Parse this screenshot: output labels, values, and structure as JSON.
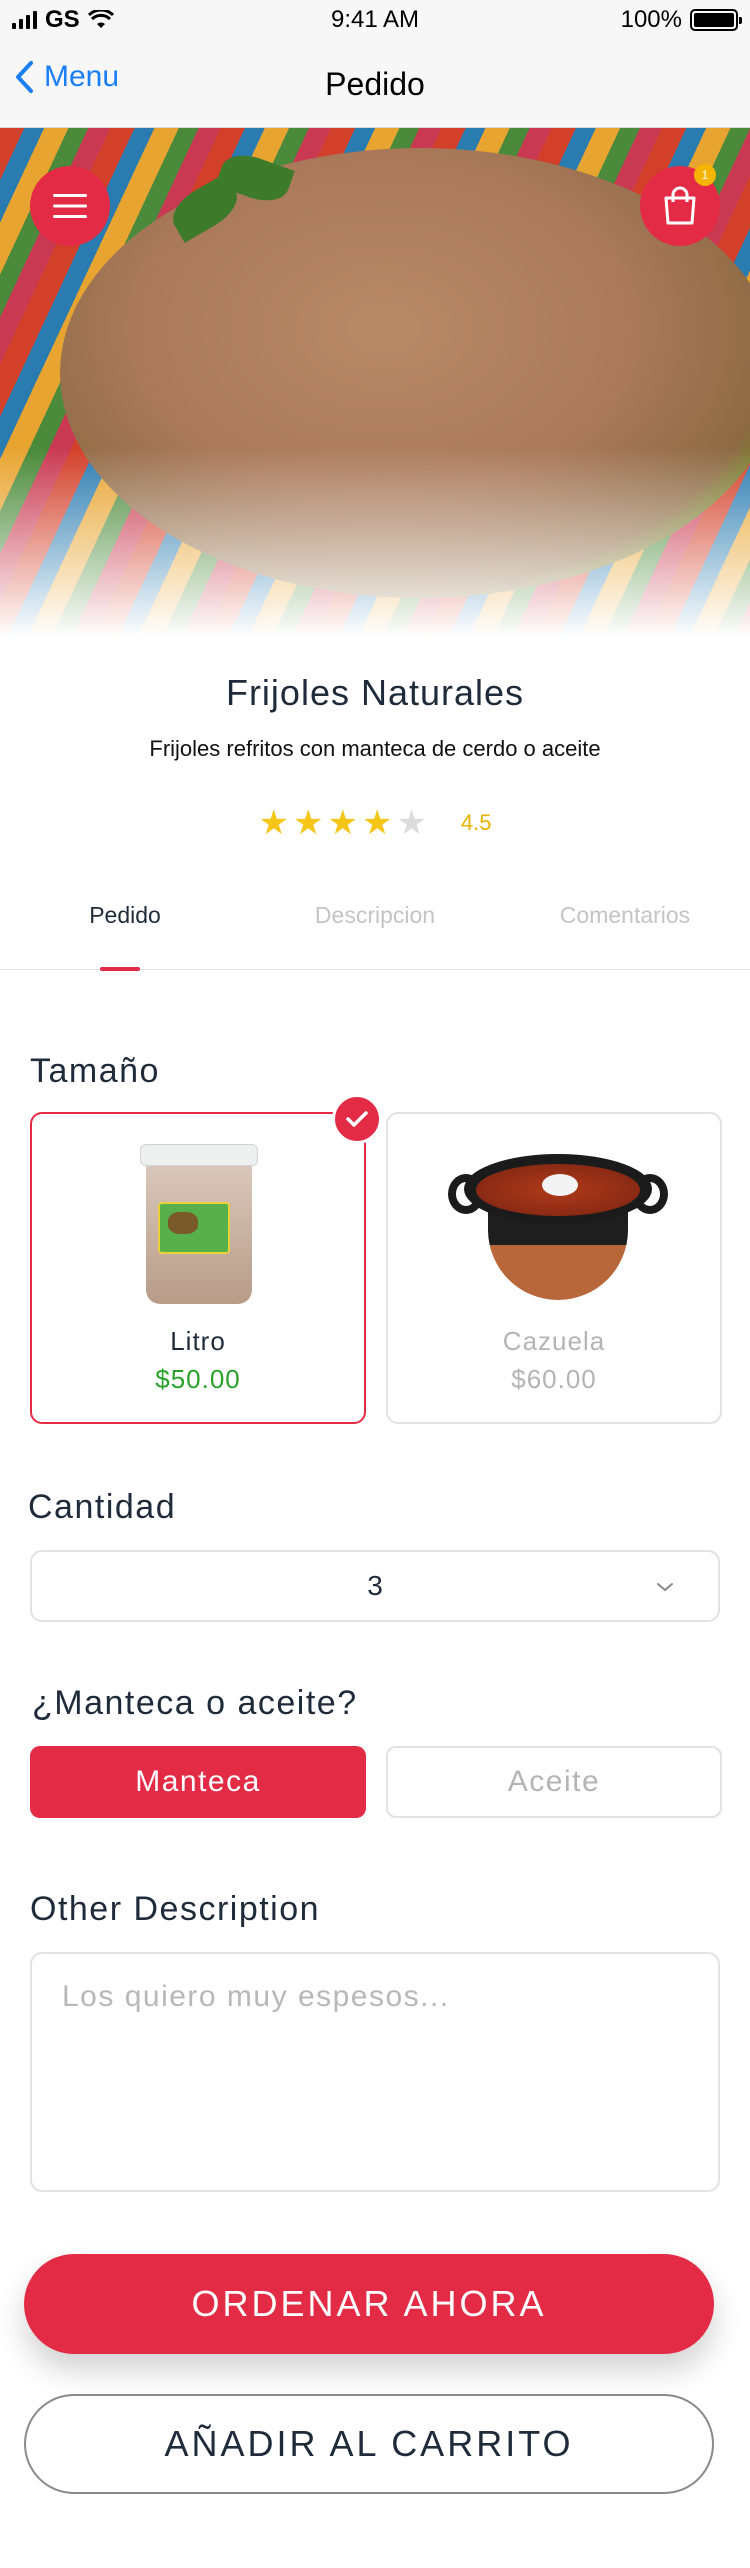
{
  "status_bar": {
    "carrier": "GS",
    "time": "9:41 AM",
    "battery": "100%"
  },
  "nav": {
    "back_label": "Menu",
    "title": "Pedido"
  },
  "hero": {
    "cart_count": "1"
  },
  "product": {
    "title": "Frijoles Naturales",
    "subtitle": "Frijoles refritos con manteca de cerdo o aceite",
    "rating_value": "4.5",
    "rating_stars": 4,
    "rating_max": 5
  },
  "tabs": [
    {
      "label": "Pedido"
    },
    {
      "label": "Descripcion"
    },
    {
      "label": "Comentarios"
    }
  ],
  "size": {
    "label": "Tamaño",
    "options": [
      {
        "name": "Litro",
        "price": "$50.00",
        "selected": true
      },
      {
        "name": "Cazuela",
        "price": "$60.00",
        "selected": false
      }
    ]
  },
  "quantity": {
    "label": "Cantidad",
    "value": "3"
  },
  "fat": {
    "label": "¿Manteca o aceite?",
    "options": [
      "Manteca",
      "Aceite"
    ],
    "selected": "Manteca"
  },
  "other": {
    "label": "Other Description",
    "placeholder": "Los quiero muy espesos..."
  },
  "actions": {
    "order_now": "ORDENAR AHORA",
    "add_to_cart": "AÑADIR AL CARRITO"
  },
  "colors": {
    "accent": "#e42b45",
    "price_green": "#2aa12a",
    "star": "#f5c518",
    "link_blue": "#1a7ef5"
  }
}
